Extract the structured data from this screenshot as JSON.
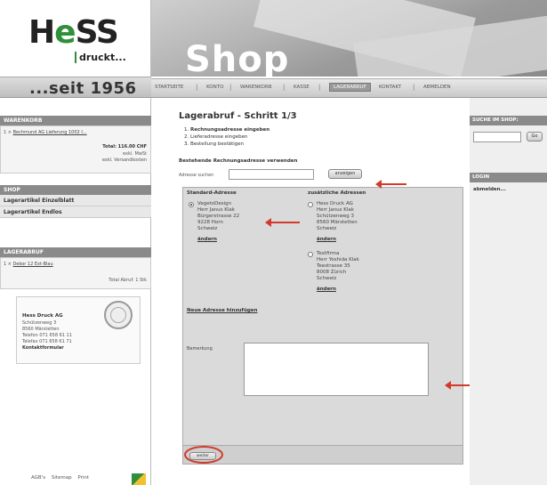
{
  "logo": {
    "brand_left": "H",
    "brand_e": "e",
    "brand_right": "SS",
    "brand_sub": "druckt..."
  },
  "since": "...seit 1956",
  "banner": {
    "title": "Shop"
  },
  "nav": {
    "items": [
      "STARTSEITE",
      "KONTO",
      "WARENKORB",
      "KASSE",
      "LAGERABRUF",
      "KONTAKT",
      "ABMELDEN"
    ]
  },
  "left": {
    "cart_heading": "WARENKORB",
    "cart_item": "Bechmund AG Lieferung 1002 I...",
    "cart_item_prefix": "1 ×",
    "cart_total": "Total: 116.00 CHF",
    "cart_tax1": "exkl. MwSt",
    "cart_tax2": "exkl. Versandkosten",
    "shop_heading": "SHOP",
    "shop_items": [
      "Lagerartikel Einzelblatt",
      "Lagerartikel Endlos"
    ],
    "abruf_heading": "LAGERABRUF",
    "abruf_item": "Dekor 12 Ext-Blau",
    "abruf_item_prefix": "1 ×",
    "abruf_total": "Total Abruf: 1 Stk",
    "company": {
      "name": "Hess Druck AG",
      "lines": [
        "Schützenweg 3",
        "8560 Märstetten",
        "Telefon 071 658 61 11",
        "Telefax 071 658 61 71"
      ],
      "contact": "Kontaktformular"
    },
    "footer_links": [
      "AGB's",
      "Sitemap",
      "Print"
    ]
  },
  "main": {
    "title": "Lagerabruf - Schritt 1/3",
    "steps": [
      {
        "num": "1.",
        "text": "Rechnungsadresse eingeben"
      },
      {
        "num": "2.",
        "text": "Lieferadresse eingeben"
      },
      {
        "num": "3.",
        "text": "Bestellung bestätigen"
      }
    ],
    "existing_label": "Bestehende Rechnungsadresse verwenden",
    "search_label": "Adresse suchen",
    "search_value": "",
    "search_button": "anzeigen",
    "standard_heading": "Standard-Adresse",
    "additional_heading": "zusätzliche Adressen",
    "standard_address": [
      "VegetoDesign",
      "Herr Janus Klak",
      "Bürgerstrasse 22",
      "9228 Horn",
      "Schweiz"
    ],
    "standard_edit": "ändern",
    "additional_addresses": [
      {
        "lines": [
          "Hess Druck AG",
          "Herr Janus Klak",
          "Schützenweg 3",
          "8560 Märstetten",
          "Schweiz"
        ],
        "edit": "ändern"
      },
      {
        "lines": [
          "Textfirma",
          "Herr Yoshida Klak",
          "Teestrasse 35",
          "8008 Zürich",
          "Schweiz"
        ],
        "edit": "ändern"
      }
    ],
    "new_address": "Neue Adresse hinzufügen",
    "remarks_label": "Bemerkung",
    "remarks_value": "",
    "submit_label": "weiter"
  },
  "right": {
    "search_heading": "SUCHE IM SHOP:",
    "search_placeholder": "",
    "search_button": "Go",
    "login_heading": "LOGIN",
    "logout": "abmelden..."
  },
  "colors": {
    "annotation": "#d23a2a",
    "brand_green": "#2f8f3a",
    "header_gray": "#8a8a8a"
  }
}
